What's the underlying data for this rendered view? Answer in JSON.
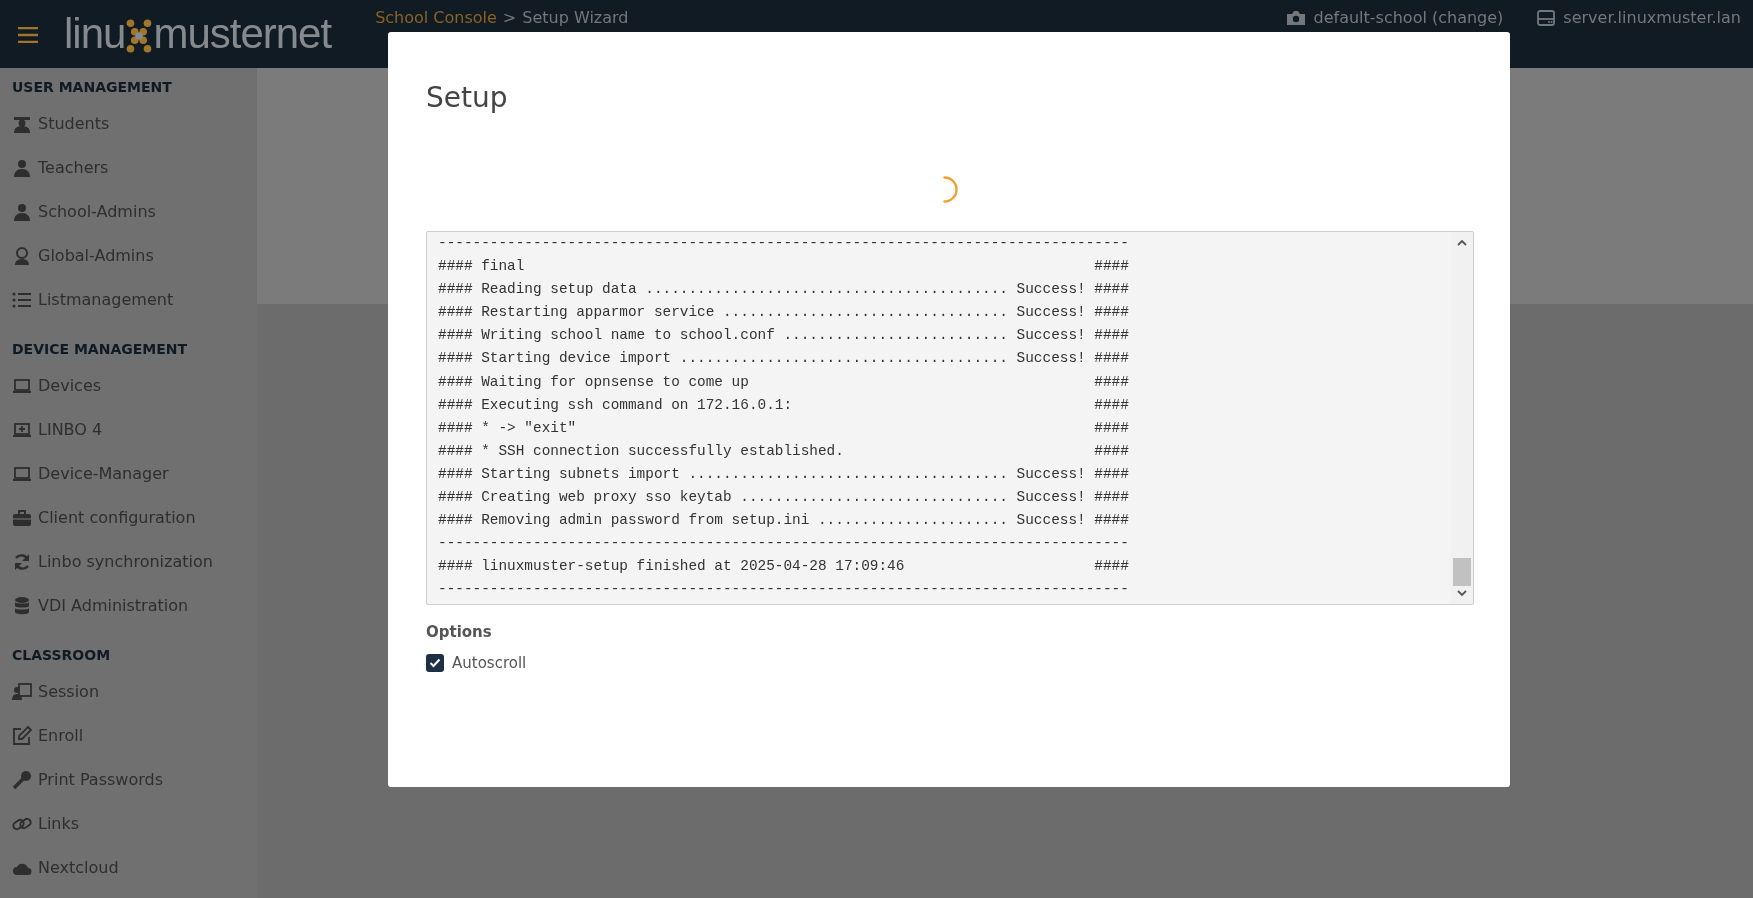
{
  "navbar": {
    "brand": {
      "parts": [
        "linu",
        "muster",
        "net"
      ]
    },
    "breadcrumb": [
      {
        "label": "School Console",
        "kind": "link"
      },
      {
        "label": ">",
        "kind": "separator"
      },
      {
        "label": "Setup Wizard",
        "kind": "current"
      }
    ],
    "school": {
      "label": "default-school (change)"
    },
    "server": {
      "label": "server.linuxmuster.lan"
    }
  },
  "sidebar": {
    "sections": [
      {
        "title": "USER MANAGEMENT",
        "items": [
          {
            "label": "Students"
          },
          {
            "label": "Teachers"
          },
          {
            "label": "School-Admins"
          },
          {
            "label": "Global-Admins"
          },
          {
            "label": "Listmanagement"
          }
        ]
      },
      {
        "title": "DEVICE MANAGEMENT",
        "items": [
          {
            "label": "Devices"
          },
          {
            "label": "LINBO 4"
          },
          {
            "label": "Device-Manager"
          },
          {
            "label": "Client configuration"
          },
          {
            "label": "Linbo synchronization"
          },
          {
            "label": "VDI Administration"
          }
        ]
      },
      {
        "title": "CLASSROOM",
        "items": [
          {
            "label": "Session"
          },
          {
            "label": "Enroll"
          },
          {
            "label": "Print Passwords"
          },
          {
            "label": "Links"
          },
          {
            "label": "Nextcloud"
          }
        ]
      }
    ]
  },
  "modal": {
    "title": "Setup",
    "loading": true,
    "log": [
      "--------------------------------------------------------------------------------",
      "#### final                                                                  ####",
      "#### Reading setup data .......................................... Success! ####",
      "#### Restarting apparmor service ................................. Success! ####",
      "#### Writing school name to school.conf .......................... Success! ####",
      "#### Starting device import ...................................... Success! ####",
      "#### Waiting for opnsense to come up                                        ####",
      "#### Executing ssh command on 172.16.0.1:                                   ####",
      "#### * -> \"exit\"                                                            ####",
      "#### * SSH connection successfully established.                             ####",
      "#### Starting subnets import ..................................... Success! ####",
      "#### Creating web proxy sso keytab ............................... Success! ####",
      "#### Removing admin password from setup.ini ...................... Success! ####",
      "--------------------------------------------------------------------------------",
      "#### linuxmuster-setup finished at 2025-04-28 17:09:46                      ####",
      "--------------------------------------------------------------------------------"
    ],
    "options": {
      "title": "Options",
      "checkboxes": [
        {
          "label": "Autoscroll",
          "checked": true
        }
      ]
    }
  }
}
